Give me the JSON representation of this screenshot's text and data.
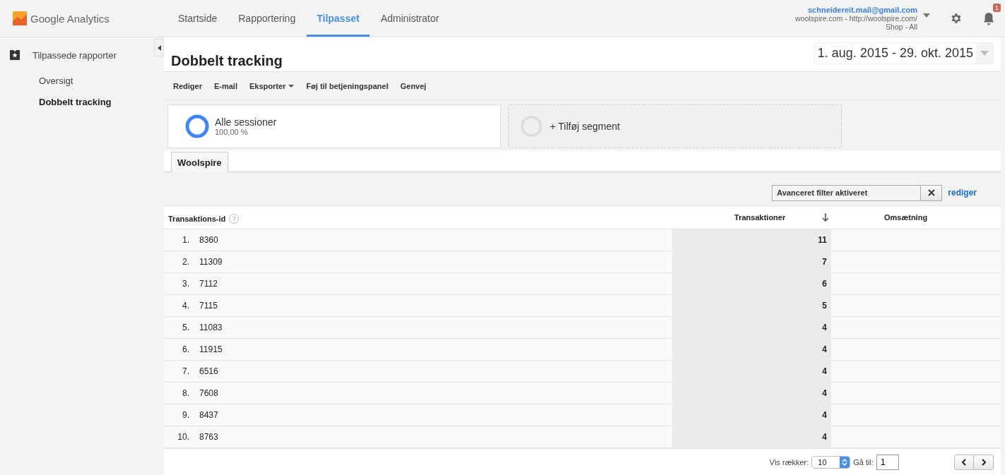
{
  "logo": {
    "text": "Google Analytics"
  },
  "nav": [
    {
      "label": "Startside",
      "selected": false
    },
    {
      "label": "Rapportering",
      "selected": false
    },
    {
      "label": "Tilpasset",
      "selected": true
    },
    {
      "label": "Administrator",
      "selected": false
    }
  ],
  "account": {
    "email": "schneidereit.mail@gmail.com",
    "property": "woolspire.com - http://woolspire.com/",
    "view": "Shop - All"
  },
  "notifications": {
    "count": "1"
  },
  "sidebar": {
    "section": "Tilpassede rapporter",
    "items": [
      {
        "label": "Oversigt",
        "selected": false
      },
      {
        "label": "Dobbelt tracking",
        "selected": true
      }
    ]
  },
  "report": {
    "title": "Dobbelt tracking",
    "date_range": "1. aug. 2015 - 29. okt. 2015"
  },
  "toolbar": [
    {
      "label": "Rediger",
      "dropdown": false
    },
    {
      "label": "E-mail",
      "dropdown": false
    },
    {
      "label": "Eksporter",
      "dropdown": true
    },
    {
      "label": "Føj til betjeningspanel",
      "dropdown": false
    },
    {
      "label": "Genvej",
      "dropdown": false
    }
  ],
  "segments": [
    {
      "kind": "active",
      "name": "Alle sessioner",
      "share": "100,00 %"
    },
    {
      "kind": "add",
      "name": "+ Tilføj segment"
    }
  ],
  "report_tabs": [
    {
      "label": "Woolspire",
      "selected": true
    }
  ],
  "filter": {
    "value": "Avanceret filter aktiveret",
    "edit_link": "rediger"
  },
  "table": {
    "columns": [
      {
        "label": "Transaktions-id",
        "help": "?",
        "sorted": false
      },
      {
        "label": "Transaktioner",
        "sorted": true
      },
      {
        "label": "Omsætning",
        "sorted": false
      }
    ],
    "rows": [
      {
        "index": "1.",
        "id": "8360",
        "transactions": "11"
      },
      {
        "index": "2.",
        "id": "11309",
        "transactions": "7"
      },
      {
        "index": "3.",
        "id": "7112",
        "transactions": "6"
      },
      {
        "index": "4.",
        "id": "7115",
        "transactions": "5"
      },
      {
        "index": "5.",
        "id": "11083",
        "transactions": "4"
      },
      {
        "index": "6.",
        "id": "11915",
        "transactions": "4"
      },
      {
        "index": "7.",
        "id": "6516",
        "transactions": "4"
      },
      {
        "index": "8.",
        "id": "7608",
        "transactions": "4"
      },
      {
        "index": "9.",
        "id": "8437",
        "transactions": "4"
      },
      {
        "index": "10.",
        "id": "8763",
        "transactions": "4"
      }
    ]
  },
  "pagination": {
    "rows_label": "Vis rækker:",
    "rows_value": "10",
    "goto_label": "Gå til:",
    "goto_value": "1"
  }
}
